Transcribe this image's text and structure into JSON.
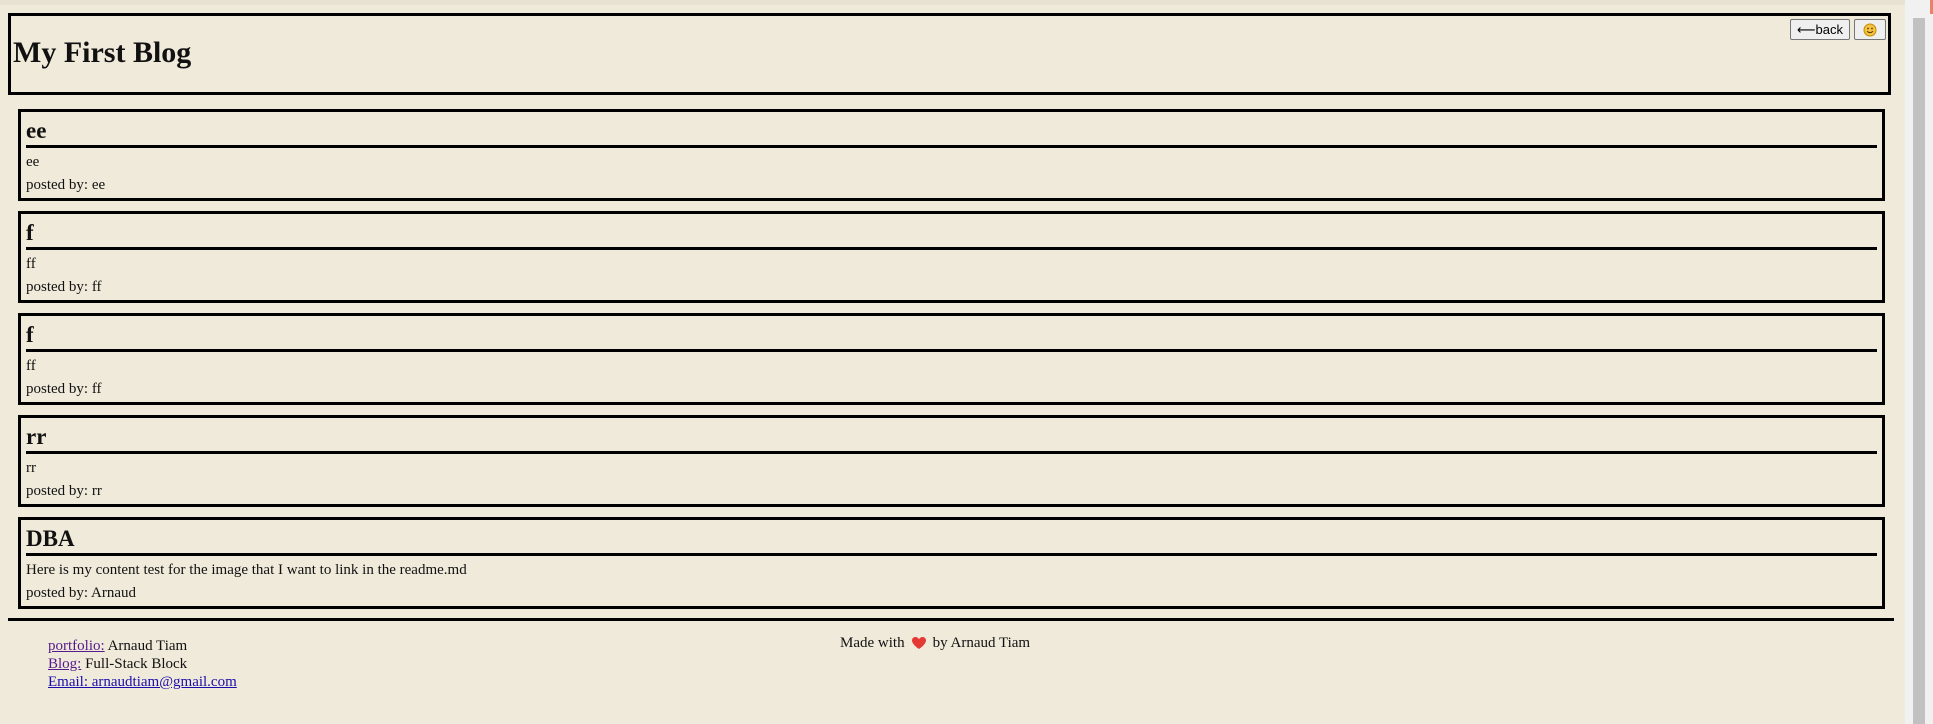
{
  "header": {
    "title": "My First Blog",
    "back_label": "⟵back",
    "emoji_icon": "smiley-icon"
  },
  "posts": [
    {
      "title": "ee",
      "content": "ee",
      "author": "posted by: ee"
    },
    {
      "title": "f",
      "content": "ff",
      "author": "posted by: ff"
    },
    {
      "title": "f",
      "content": "ff",
      "author": "posted by: ff"
    },
    {
      "title": "rr",
      "content": "rr",
      "author": "posted by: rr"
    },
    {
      "title": "DBA",
      "content": "Here is my content test for the image that I want to link in the readme.md",
      "author": "posted by: Arnaud"
    }
  ],
  "footer": {
    "portfolio_link": "portfolio:",
    "portfolio_text": " Arnaud Tiam",
    "blog_link": "Blog:",
    "blog_text": " Full-Stack Block",
    "email_link": "Email: arnaudtiam@gmail.com",
    "made_with": "Made with",
    "made_by": "by Arnaud Tiam",
    "heart_icon": "heart-icon",
    "heart_color": "#e53935"
  }
}
